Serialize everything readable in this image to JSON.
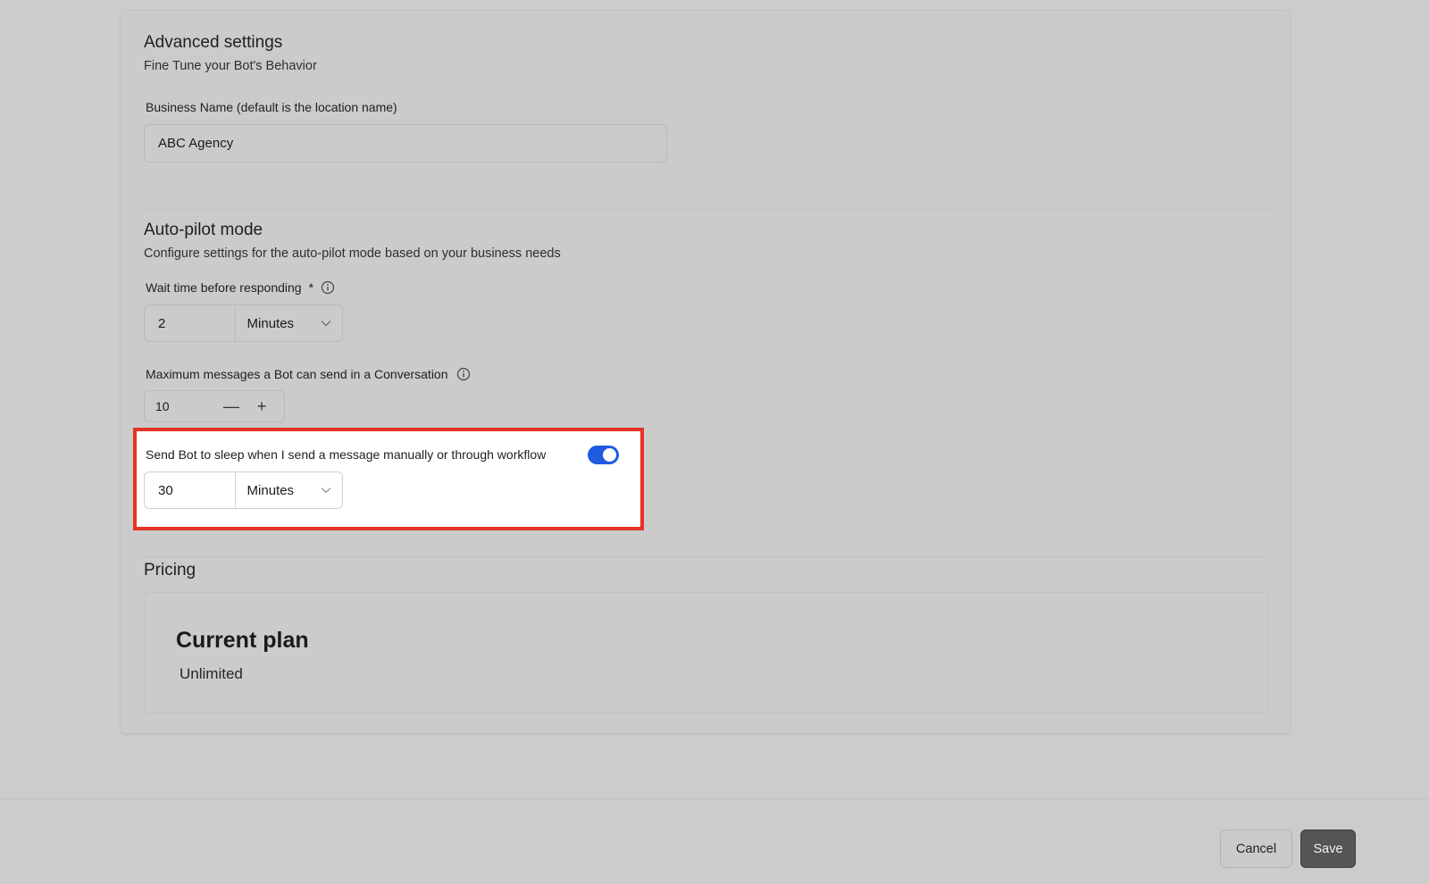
{
  "advanced": {
    "title": "Advanced settings",
    "subtitle": "Fine Tune your Bot's Behavior",
    "business_name_label": "Business Name (default is the location name)",
    "business_name_value": "ABC Agency"
  },
  "autopilot": {
    "title": "Auto-pilot mode",
    "subtitle": "Configure settings for the auto-pilot mode based on your business needs",
    "wait_label": "Wait time before responding",
    "wait_required": "*",
    "wait_value": "2",
    "wait_unit": "Minutes",
    "max_label": "Maximum messages a Bot can send in a Conversation",
    "max_value": "10",
    "minus": "—",
    "plus": "+",
    "sleep_label": "Send Bot to sleep when I send a message manually or through workflow",
    "sleep_enabled": true,
    "sleep_value": "30",
    "sleep_unit": "Minutes"
  },
  "pricing": {
    "title": "Pricing",
    "plan_title": "Current plan",
    "plan_value": "Unlimited"
  },
  "footer": {
    "cancel_label": "Cancel",
    "save_label": "Save"
  },
  "colors": {
    "highlight": "#e53225",
    "toggle": "#1f5ae0",
    "save_bg": "#555555"
  },
  "icons": {
    "info": "info-icon",
    "chevron": "chevron-down-icon"
  }
}
